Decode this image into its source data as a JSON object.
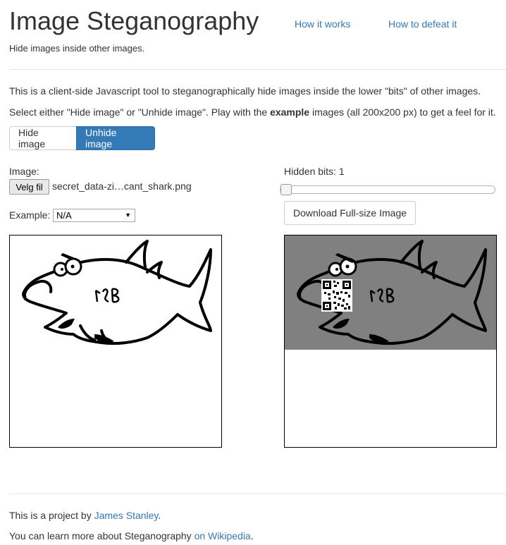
{
  "header": {
    "title": "Image Steganography",
    "nav": [
      "How it works",
      "How to defeat it"
    ],
    "tagline": "Hide images inside other images."
  },
  "intro": {
    "line1": "This is a client-side Javascript tool to steganographically hide images inside the lower \"bits\" of other images.",
    "line2_pre": "Select either \"Hide image\" or \"Unhide image\". Play with the ",
    "line2_bold": "example",
    "line2_post": " images (all 200x200 px) to get a feel for it."
  },
  "mode": {
    "hide_label": "Hide image",
    "unhide_label": "Unhide image",
    "active": "Unhide image"
  },
  "form": {
    "image_label": "Image:",
    "file_button": "Velg fil",
    "file_name": "secret_data-zi…cant_shark.png",
    "example_label": "Example:",
    "example_value": "N/A",
    "hidden_bits_label": "Hidden bits: 1",
    "hidden_bits": 1,
    "download_label": "Download Full-size Image"
  },
  "footer": {
    "line1_pre": "This is a project by ",
    "line1_link": "James Stanley",
    "line1_post": ".",
    "line2_pre": "You can learn more about Steganography ",
    "line2_link": "on Wikipedia",
    "line2_post": "."
  },
  "colors": {
    "accent": "#337ab7",
    "revealed_bg": "#808080"
  }
}
